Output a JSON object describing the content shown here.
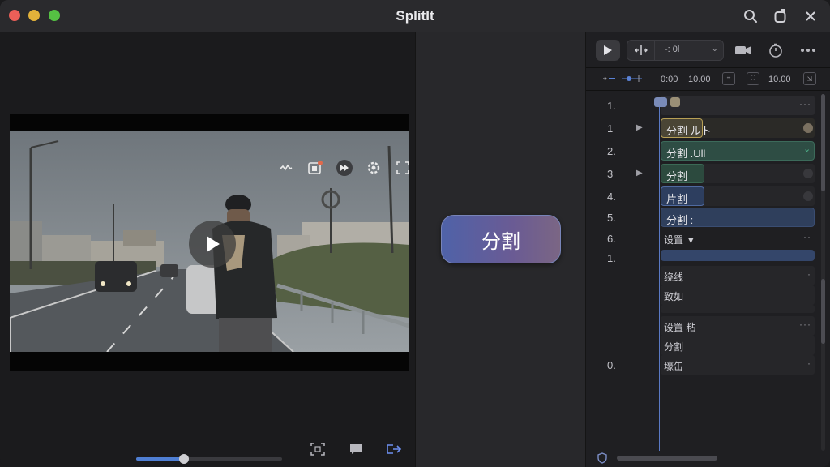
{
  "window": {
    "title": "SplitIt"
  },
  "titlebar": {
    "icons": [
      "search-icon",
      "share-icon",
      "close-icon"
    ]
  },
  "video": {
    "overlay_icons": [
      "waveform-icon",
      "badge-icon",
      "fast-forward-icon",
      "settings-icon",
      "fullscreen-icon"
    ],
    "playback_progress": 0.33
  },
  "main": {
    "split_button_label": "分割"
  },
  "panel": {
    "toolbar": {
      "segment_text": "-: 0l"
    },
    "ruler": {
      "time_a": "0:00",
      "time_b": "10.00",
      "time_c": "10.00"
    },
    "rows": [
      {
        "num": "1.",
        "label": "",
        "type": "header"
      },
      {
        "num": "1",
        "label": "分割 ルト",
        "type": "clip",
        "color": "#4a4535",
        "border": "#b79f55",
        "arrow": true
      },
      {
        "num": "2.",
        "label": "分割 .Ull",
        "type": "clip",
        "color": "#2e4d44",
        "border": "#3c6a5a",
        "arrow": false
      },
      {
        "num": "3",
        "label": "分割",
        "type": "clip",
        "color": "#2c4a3e",
        "border": "#3b6a55",
        "arrow": true
      },
      {
        "num": "4.",
        "label": "片割",
        "type": "clip",
        "color": "#2d3e5f",
        "border": "#4f6aa0",
        "arrow": false
      },
      {
        "num": "5.",
        "label": "分割 :",
        "type": "clip",
        "color": "#2f3f5c",
        "border": "#3a4d72",
        "arrow": false
      },
      {
        "num": "6.",
        "label": "设置 ▼",
        "type": "plain"
      },
      {
        "num": "1.",
        "label": "",
        "type": "bar"
      },
      {
        "num": "",
        "label": "绕线",
        "type": "plain"
      },
      {
        "num": "",
        "label": "致如",
        "type": "plain"
      },
      {
        "num": "",
        "label": "",
        "type": "empty"
      },
      {
        "num": "",
        "label": "设置 粘",
        "type": "plain"
      },
      {
        "num": "",
        "label": "分割",
        "type": "plain"
      },
      {
        "num": "0.",
        "label": "壕缶",
        "type": "plain"
      }
    ]
  }
}
